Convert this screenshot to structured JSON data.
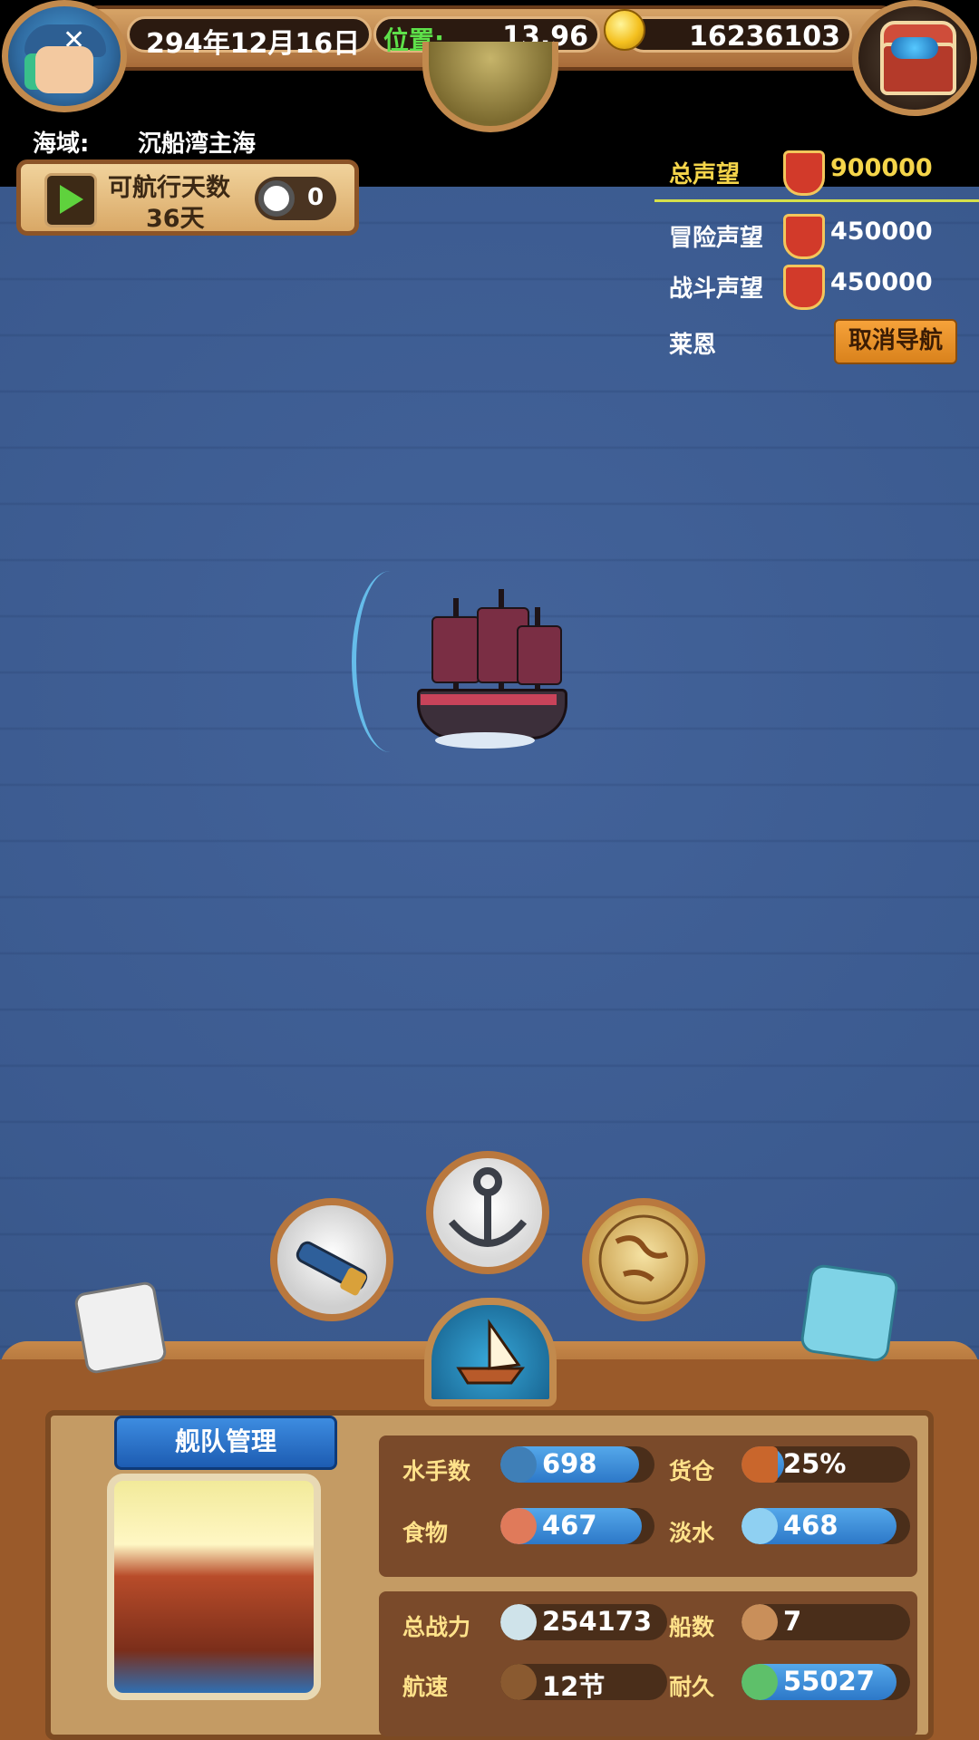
{
  "header": {
    "date": "294年12月16日",
    "position_label": "位置:",
    "position_value": "13,96",
    "gold": "16236103"
  },
  "region": {
    "label": "海域:",
    "value": "沉船湾主海"
  },
  "navigation": {
    "title": "可航行天数",
    "days": "36天",
    "toggle_count": "0"
  },
  "reputation": {
    "total_label": "总声望",
    "total_value": "900000",
    "rows": [
      {
        "label": "冒险声望",
        "value": "450000",
        "icon": "adventure-shield-icon"
      },
      {
        "label": "战斗声望",
        "value": "450000",
        "icon": "battle-shield-icon"
      }
    ],
    "destination_label": "莱恩",
    "cancel_button": "取消导航"
  },
  "actions": [
    {
      "name": "spyglass",
      "icon": "spyglass-icon"
    },
    {
      "name": "anchor",
      "icon": "anchor-icon"
    },
    {
      "name": "world-map",
      "icon": "world-map-icon"
    },
    {
      "name": "ship",
      "icon": "ship-icon"
    }
  ],
  "fleet": {
    "banner": "舰队管理",
    "stats_top": [
      {
        "label": "水手数",
        "value": "698",
        "icon": "sailor-icon",
        "fill": 0.9
      },
      {
        "label": "货仓",
        "value": "25%",
        "icon": "cargo-crate-icon",
        "fill": 0.25
      },
      {
        "label": "食物",
        "value": "467",
        "icon": "meat-icon",
        "fill": 0.92
      },
      {
        "label": "淡水",
        "value": "468",
        "icon": "water-jug-icon",
        "fill": 0.92
      }
    ],
    "stats_bottom": [
      {
        "label": "总战力",
        "value": "254173",
        "icon": "skull-icon",
        "fill": 0.0
      },
      {
        "label": "船数",
        "value": "7",
        "icon": "ships-icon",
        "fill": 0.0
      },
      {
        "label": "航速",
        "value": "12节",
        "icon": "speed-ship-icon",
        "fill": 0.0
      },
      {
        "label": "耐久",
        "value": "55027",
        "icon": "durability-icon",
        "fill": 0.92
      }
    ]
  },
  "colors": {
    "sea": "#3b5a8f",
    "accent_gold": "#f5d54a",
    "bar_blue": "#3d8ce0"
  }
}
